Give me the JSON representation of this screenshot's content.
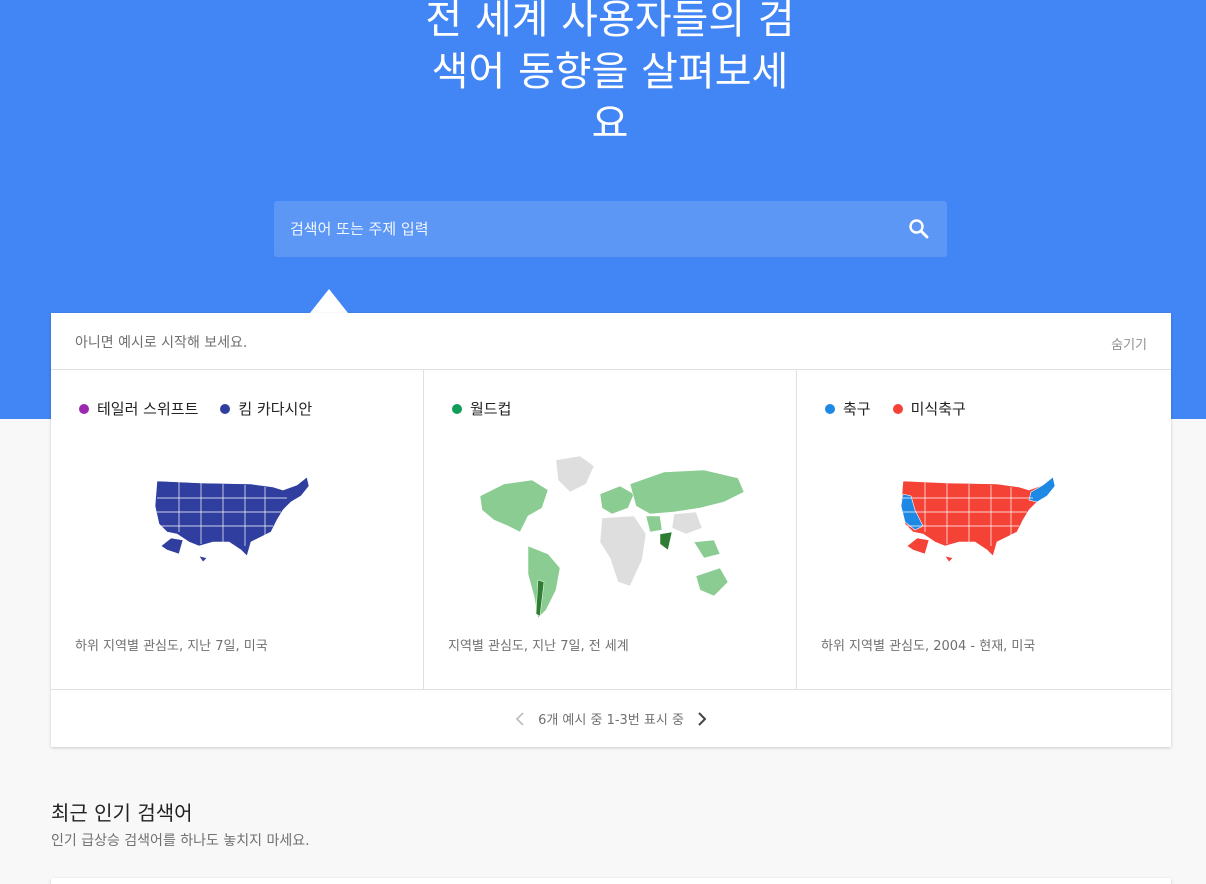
{
  "hero": {
    "title_lines": [
      "전 세계 사용자들의 검",
      "색어 동향을 살펴보세",
      "요"
    ]
  },
  "search": {
    "placeholder": "검색어 또는 주제 입력",
    "icon": "search-icon"
  },
  "examples_card": {
    "intro": "아니면 예시로 시작해 보세요.",
    "hide_label": "숨기기",
    "examples": [
      {
        "legend": [
          {
            "label": "테일러 스위프트",
            "color": "#9c27b0"
          },
          {
            "label": "킴 카다시안",
            "color": "#303f9f"
          }
        ],
        "map": "us-map",
        "caption": "하위 지역별 관심도, 지난 7일, 미국"
      },
      {
        "legend": [
          {
            "label": "월드컵",
            "color": "#0f9d58"
          }
        ],
        "map": "world-map",
        "caption": "지역별 관심도, 지난 7일, 전 세계"
      },
      {
        "legend": [
          {
            "label": "축구",
            "color": "#1e88e5"
          },
          {
            "label": "미식축구",
            "color": "#f44336"
          }
        ],
        "map": "us-map",
        "caption": "하위 지역별 관심도, 2004 - 현재, 미국"
      }
    ],
    "pager_text": "6개 예시 중 1-3번 표시 중",
    "prev_icon": "chevron-left-icon",
    "next_icon": "chevron-right-icon"
  },
  "trending": {
    "title": "최근 인기 검색어",
    "subtitle": "인기 급상승 검색어를 하나도 놓치지 마세요."
  }
}
